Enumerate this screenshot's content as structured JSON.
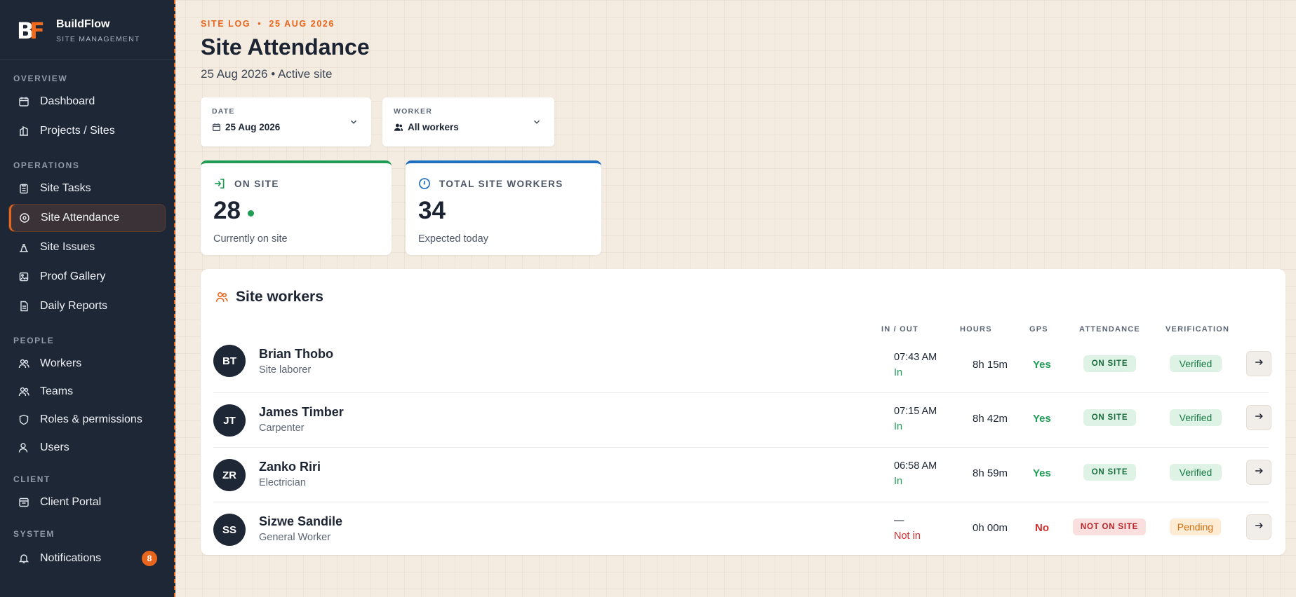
{
  "brand": {
    "name": "BuildFlow",
    "sub": "SITE MANAGEMENT"
  },
  "nav": {
    "overview_label": "OVERVIEW",
    "operations_label": "OPERATIONS",
    "people_label": "PEOPLE",
    "client_label": "CLIENT",
    "system_label": "SYSTEM",
    "dashboard": "Dashboard",
    "projects": "Projects / Sites",
    "tasks": "Site Tasks",
    "attendance": "Site Attendance",
    "issues": "Site Issues",
    "gallery": "Proof Gallery",
    "reports": "Daily Reports",
    "workers": "Workers",
    "teams": "Teams",
    "roles": "Roles & permissions",
    "users": "Users",
    "portal": "Client Portal",
    "notifications": "Notifications",
    "notifications_count": "8"
  },
  "header": {
    "eyebrow": "SITE LOG  •  25 AUG 2026",
    "title": "Site Attendance",
    "subtitle": "25 Aug 2026 • Active site"
  },
  "filters": {
    "date_label": "DATE",
    "date_value": "25 Aug 2026",
    "worker_label": "WORKER",
    "worker_value": "All workers"
  },
  "stats": {
    "on_site_label": "ON SITE",
    "on_site_value": "28",
    "on_site_note": "Currently on site",
    "total_label": "TOTAL SITE WORKERS",
    "total_value": "34",
    "total_note": "Expected today"
  },
  "workers": {
    "title": "Site workers",
    "columns": {
      "inout": "IN / OUT",
      "hours": "HOURS",
      "gps": "GPS",
      "attendance": "ATTENDANCE",
      "verification": "VERIFICATION"
    },
    "rows": [
      {
        "initials": "BT",
        "name": "Brian Thobo",
        "role": "Site laborer",
        "time": "07:43 AM",
        "state": "In",
        "hours": "8h 15m",
        "gps": "Yes",
        "attendance": "ON SITE",
        "verification": "Verified"
      },
      {
        "initials": "JT",
        "name": "James Timber",
        "role": "Carpenter",
        "time": "07:15 AM",
        "state": "In",
        "hours": "8h 42m",
        "gps": "Yes",
        "attendance": "ON SITE",
        "verification": "Verified"
      },
      {
        "initials": "ZR",
        "name": "Zanko Riri",
        "role": "Electrician",
        "time": "06:58 AM",
        "state": "In",
        "hours": "8h 59m",
        "gps": "Yes",
        "attendance": "ON SITE",
        "verification": "Verified"
      },
      {
        "initials": "SS",
        "name": "Sizwe Sandile",
        "role": "General Worker",
        "time": "—",
        "state": "Not in",
        "hours": "0h 00m",
        "gps": "No",
        "attendance": "NOT ON SITE",
        "verification": "Pending"
      }
    ]
  },
  "colors": {
    "accent": "#e8651e",
    "sidebar": "#1e2736",
    "success": "#1f9d55",
    "danger": "#d12e2e",
    "info": "#1f6fbf"
  }
}
